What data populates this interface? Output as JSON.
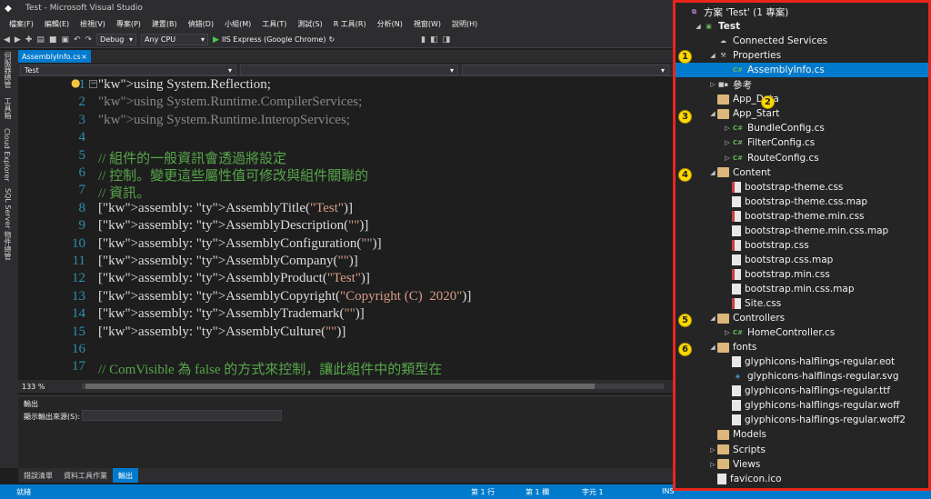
{
  "window": {
    "title": "Test - Microsoft Visual Studio"
  },
  "menu": [
    "檔案(F)",
    "編輯(E)",
    "檢視(V)",
    "專案(P)",
    "建置(B)",
    "偵錯(D)",
    "小組(M)",
    "工具(T)",
    "測試(S)",
    "R 工具(R)",
    "分析(N)",
    "視窗(W)",
    "說明(H)"
  ],
  "toolbar": {
    "config": "Debug",
    "platform": "Any CPU",
    "run_label": "IIS Express (Google Chrome)"
  },
  "side_tabs": [
    "伺服器總管",
    "工具箱",
    "Cloud Explorer",
    "SQL Server 物件總管"
  ],
  "doc_tab": {
    "label": "AssemblyInfo.cs",
    "close": "×"
  },
  "nav": {
    "project": "Test"
  },
  "editor": {
    "lines": [
      {
        "n": "1",
        "text": "using System.Reflection;"
      },
      {
        "n": "2",
        "text": "using System.Runtime.CompilerServices;"
      },
      {
        "n": "3",
        "text": "using System.Runtime.InteropServices;"
      },
      {
        "n": "4",
        "text": ""
      },
      {
        "n": "5",
        "text": "// 組件的一般資訊會透過將設定"
      },
      {
        "n": "6",
        "text": "// 控制。變更這些屬性值可修改與組件關聯的"
      },
      {
        "n": "7",
        "text": "// 資訊。"
      },
      {
        "n": "8",
        "text": "[assembly: AssemblyTitle(\"Test\")]"
      },
      {
        "n": "9",
        "text": "[assembly: AssemblyDescription(\"\")]"
      },
      {
        "n": "10",
        "text": "[assembly: AssemblyConfiguration(\"\")]"
      },
      {
        "n": "11",
        "text": "[assembly: AssemblyCompany(\"\")]"
      },
      {
        "n": "12",
        "text": "[assembly: AssemblyProduct(\"Test\")]"
      },
      {
        "n": "13",
        "text": "[assembly: AssemblyCopyright(\"Copyright (C)  2020\")]"
      },
      {
        "n": "14",
        "text": "[assembly: AssemblyTrademark(\"\")]"
      },
      {
        "n": "15",
        "text": "[assembly: AssemblyCulture(\"\")]"
      },
      {
        "n": "16",
        "text": ""
      },
      {
        "n": "17",
        "text": "// ComVisible 為 false 的方式來控制，讓此組件中的類型在"
      }
    ]
  },
  "zoom": "133 %",
  "output": {
    "title": "輸出",
    "source_label": "顯示輸出來源(S):"
  },
  "bottom_tabs": [
    {
      "label": "錯誤清單",
      "active": false
    },
    {
      "label": "資料工具作業",
      "active": false
    },
    {
      "label": "輸出",
      "active": true
    }
  ],
  "status": {
    "ready": "就緒",
    "line": "第 1 行",
    "col": "第 1 欄",
    "char": "字元 1",
    "mode": "INS"
  },
  "solution_explorer": {
    "items": [
      {
        "label": "方案 'Test' (1 專案)",
        "indent": 0,
        "arrow": "",
        "icon": "solution"
      },
      {
        "label": "Test",
        "indent": 1,
        "arrow": "open",
        "icon": "project"
      },
      {
        "label": "Connected Services",
        "indent": 2,
        "arrow": "",
        "icon": "cloud"
      },
      {
        "label": "Properties",
        "indent": 2,
        "arrow": "open",
        "icon": "wrench"
      },
      {
        "label": "AssemblyInfo.cs",
        "indent": 3,
        "arrow": "",
        "icon": "cs",
        "selected": true
      },
      {
        "label": "參考",
        "indent": 2,
        "arrow": "closed",
        "icon": "ref"
      },
      {
        "label": "App_Data",
        "indent": 2,
        "arrow": "",
        "icon": "folder"
      },
      {
        "label": "App_Start",
        "indent": 2,
        "arrow": "open",
        "icon": "folder"
      },
      {
        "label": "BundleConfig.cs",
        "indent": 3,
        "arrow": "closed",
        "icon": "cs"
      },
      {
        "label": "FilterConfig.cs",
        "indent": 3,
        "arrow": "closed",
        "icon": "cs"
      },
      {
        "label": "RouteConfig.cs",
        "indent": 3,
        "arrow": "closed",
        "icon": "cs"
      },
      {
        "label": "Content",
        "indent": 2,
        "arrow": "open",
        "icon": "folder"
      },
      {
        "label": "bootstrap-theme.css",
        "indent": 3,
        "arrow": "",
        "icon": "css"
      },
      {
        "label": "bootstrap-theme.css.map",
        "indent": 3,
        "arrow": "",
        "icon": "file"
      },
      {
        "label": "bootstrap-theme.min.css",
        "indent": 3,
        "arrow": "",
        "icon": "css"
      },
      {
        "label": "bootstrap-theme.min.css.map",
        "indent": 3,
        "arrow": "",
        "icon": "file"
      },
      {
        "label": "bootstrap.css",
        "indent": 3,
        "arrow": "",
        "icon": "css"
      },
      {
        "label": "bootstrap.css.map",
        "indent": 3,
        "arrow": "",
        "icon": "file"
      },
      {
        "label": "bootstrap.min.css",
        "indent": 3,
        "arrow": "",
        "icon": "css"
      },
      {
        "label": "bootstrap.min.css.map",
        "indent": 3,
        "arrow": "",
        "icon": "file"
      },
      {
        "label": "Site.css",
        "indent": 3,
        "arrow": "",
        "icon": "css"
      },
      {
        "label": "Controllers",
        "indent": 2,
        "arrow": "open",
        "icon": "folder"
      },
      {
        "label": "HomeController.cs",
        "indent": 3,
        "arrow": "closed",
        "icon": "cs"
      },
      {
        "label": "fonts",
        "indent": 2,
        "arrow": "open",
        "icon": "folder"
      },
      {
        "label": "glyphicons-halflings-regular.eot",
        "indent": 3,
        "arrow": "",
        "icon": "file"
      },
      {
        "label": "glyphicons-halflings-regular.svg",
        "indent": 3,
        "arrow": "",
        "icon": "svg"
      },
      {
        "label": "glyphicons-halflings-regular.ttf",
        "indent": 3,
        "arrow": "",
        "icon": "file"
      },
      {
        "label": "glyphicons-halflings-regular.woff",
        "indent": 3,
        "arrow": "",
        "icon": "file"
      },
      {
        "label": "glyphicons-halflings-regular.woff2",
        "indent": 3,
        "arrow": "",
        "icon": "file"
      },
      {
        "label": "Models",
        "indent": 2,
        "arrow": "",
        "icon": "folder"
      },
      {
        "label": "Scripts",
        "indent": 2,
        "arrow": "closed",
        "icon": "folder"
      },
      {
        "label": "Views",
        "indent": 2,
        "arrow": "closed",
        "icon": "folder"
      },
      {
        "label": "favicon.ico",
        "indent": 2,
        "arrow": "",
        "icon": "file"
      }
    ],
    "markers": [
      "1",
      "2",
      "3",
      "4",
      "5",
      "6"
    ]
  },
  "colors": {
    "accent": "#007acc",
    "highlight_border": "#e8261c",
    "marker": "#ffd800"
  }
}
